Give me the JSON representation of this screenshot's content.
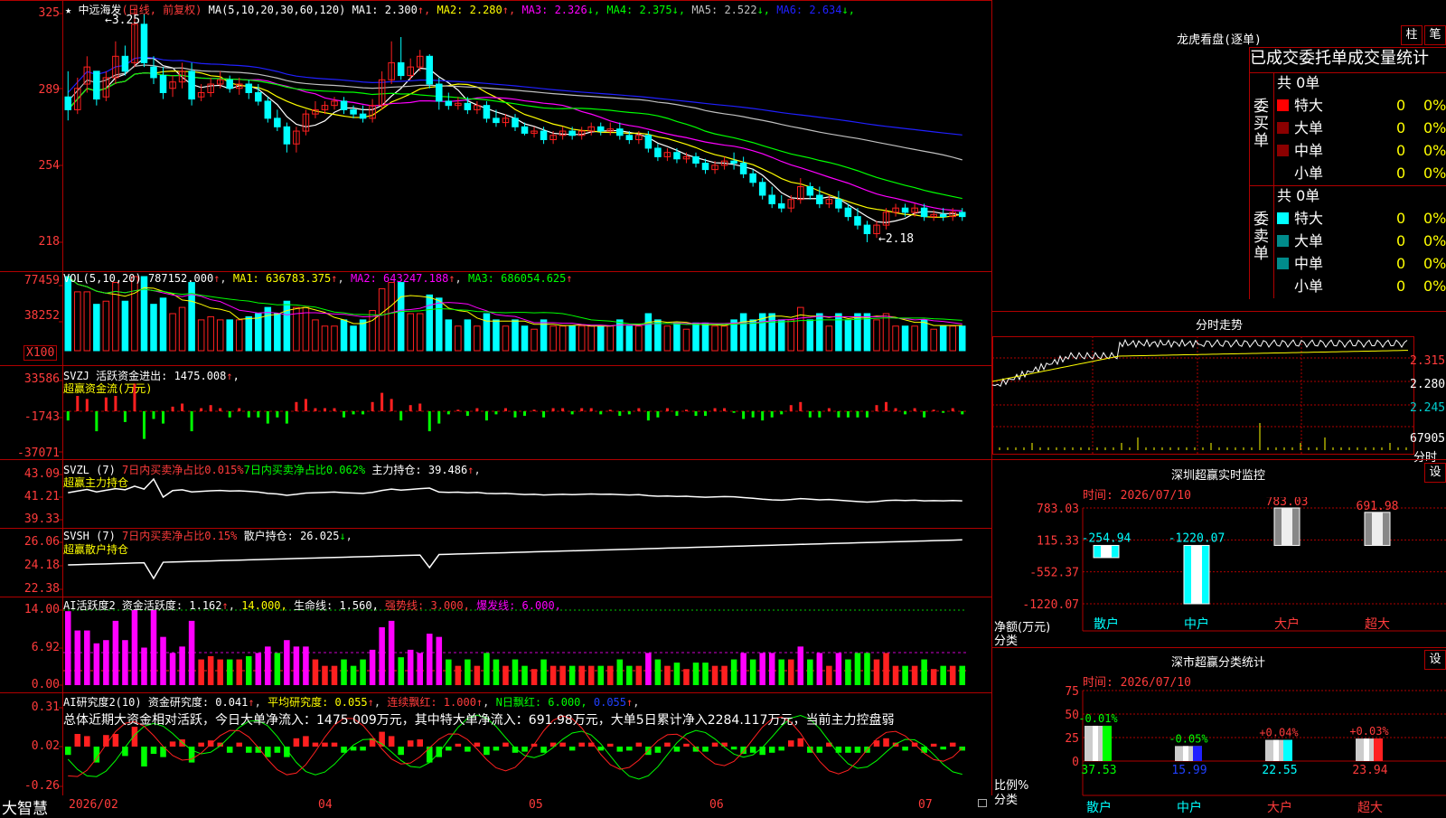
{
  "app": {
    "name": "大智慧"
  },
  "stock": {
    "name": "中远海发",
    "period": "(日线, 前复权)"
  },
  "kline": {
    "ma_header": "MA(5,10,20,30,60,120)",
    "ma": [
      {
        "label": "MA1:",
        "value": "2.300",
        "arrow": "↑",
        "color": "#ffffff"
      },
      {
        "label": "MA2:",
        "value": "2.280",
        "arrow": "↑",
        "color": "#ffff00"
      },
      {
        "label": "MA3:",
        "value": "2.326",
        "arrow": "↓",
        "color": "#ff00ff"
      },
      {
        "label": "MA4:",
        "value": "2.375",
        "arrow": "↓",
        "color": "#00ff00"
      },
      {
        "label": "MA5:",
        "value": "2.522",
        "arrow": "↓",
        "color": "#c0c0c0"
      },
      {
        "label": "MA6:",
        "value": "2.634",
        "arrow": "↓",
        "color": "#2020ff"
      }
    ],
    "y_ticks": [
      "325",
      "289",
      "254",
      "218"
    ],
    "high_mark": "3.25",
    "low_mark": "2.18",
    "candles": [
      [
        2.86,
        2.98,
        2.8,
        2.75
      ],
      [
        2.8,
        2.95,
        2.9,
        2.78
      ],
      [
        2.92,
        3.05,
        3.0,
        2.88
      ],
      [
        2.98,
        2.95,
        2.85,
        2.82
      ],
      [
        2.86,
        2.98,
        2.95,
        2.84
      ],
      [
        2.95,
        3.12,
        3.05,
        2.92
      ],
      [
        3.05,
        3.1,
        2.98,
        2.96
      ],
      [
        3.02,
        3.28,
        3.2,
        3.0
      ],
      [
        3.2,
        3.25,
        3.02,
        3.0
      ],
      [
        3.0,
        3.05,
        2.95,
        2.92
      ],
      [
        2.96,
        3.0,
        2.88,
        2.85
      ],
      [
        2.9,
        2.96,
        2.93,
        2.86
      ],
      [
        2.93,
        3.02,
        2.98,
        2.9
      ],
      [
        2.98,
        3.02,
        2.85,
        2.82
      ],
      [
        2.86,
        2.92,
        2.88,
        2.84
      ],
      [
        2.88,
        2.95,
        2.92,
        2.86
      ],
      [
        2.92,
        2.98,
        2.94,
        2.9
      ],
      [
        2.94,
        2.96,
        2.9,
        2.88
      ],
      [
        2.9,
        2.95,
        2.92,
        2.87
      ],
      [
        2.92,
        2.94,
        2.88,
        2.85
      ],
      [
        2.88,
        2.92,
        2.84,
        2.82
      ],
      [
        2.84,
        2.86,
        2.76,
        2.74
      ],
      [
        2.76,
        2.8,
        2.72,
        2.7
      ],
      [
        2.72,
        2.74,
        2.64,
        2.6
      ],
      [
        2.64,
        2.72,
        2.7,
        2.6
      ],
      [
        2.7,
        2.8,
        2.78,
        2.68
      ],
      [
        2.78,
        2.84,
        2.8,
        2.76
      ],
      [
        2.8,
        2.84,
        2.82,
        2.78
      ],
      [
        2.82,
        2.86,
        2.84,
        2.8
      ],
      [
        2.84,
        2.86,
        2.8,
        2.78
      ],
      [
        2.8,
        2.82,
        2.78,
        2.76
      ],
      [
        2.78,
        2.82,
        2.76,
        2.74
      ],
      [
        2.76,
        2.85,
        2.82,
        2.74
      ],
      [
        2.82,
        2.98,
        2.94,
        2.8
      ],
      [
        2.94,
        3.12,
        3.02,
        2.92
      ],
      [
        3.02,
        3.14,
        2.96,
        2.94
      ],
      [
        2.96,
        3.04,
        3.0,
        2.94
      ],
      [
        3.0,
        3.08,
        3.05,
        2.98
      ],
      [
        3.05,
        3.06,
        2.92,
        2.9
      ],
      [
        2.92,
        2.95,
        2.84,
        2.8
      ],
      [
        2.84,
        2.88,
        2.82,
        2.8
      ],
      [
        2.82,
        2.86,
        2.83,
        2.8
      ],
      [
        2.83,
        2.86,
        2.8,
        2.78
      ],
      [
        2.8,
        2.84,
        2.82,
        2.78
      ],
      [
        2.82,
        2.84,
        2.76,
        2.74
      ],
      [
        2.76,
        2.8,
        2.74,
        2.72
      ],
      [
        2.74,
        2.78,
        2.76,
        2.72
      ],
      [
        2.76,
        2.78,
        2.72,
        2.7
      ],
      [
        2.72,
        2.74,
        2.69,
        2.68
      ],
      [
        2.69,
        2.72,
        2.7,
        2.67
      ],
      [
        2.7,
        2.72,
        2.66,
        2.64
      ],
      [
        2.66,
        2.7,
        2.68,
        2.64
      ],
      [
        2.68,
        2.72,
        2.7,
        2.66
      ],
      [
        2.7,
        2.72,
        2.68,
        2.66
      ],
      [
        2.68,
        2.72,
        2.7,
        2.66
      ],
      [
        2.7,
        2.74,
        2.72,
        2.68
      ],
      [
        2.72,
        2.74,
        2.7,
        2.68
      ],
      [
        2.7,
        2.74,
        2.71,
        2.68
      ],
      [
        2.71,
        2.74,
        2.68,
        2.66
      ],
      [
        2.68,
        2.7,
        2.66,
        2.64
      ],
      [
        2.66,
        2.7,
        2.68,
        2.64
      ],
      [
        2.68,
        2.7,
        2.62,
        2.6
      ],
      [
        2.62,
        2.64,
        2.58,
        2.56
      ],
      [
        2.58,
        2.62,
        2.6,
        2.56
      ],
      [
        2.6,
        2.62,
        2.57,
        2.55
      ],
      [
        2.57,
        2.6,
        2.58,
        2.55
      ],
      [
        2.58,
        2.6,
        2.55,
        2.53
      ],
      [
        2.55,
        2.57,
        2.52,
        2.5
      ],
      [
        2.52,
        2.56,
        2.54,
        2.5
      ],
      [
        2.54,
        2.58,
        2.56,
        2.52
      ],
      [
        2.56,
        2.6,
        2.55,
        2.52
      ],
      [
        2.55,
        2.58,
        2.5,
        2.48
      ],
      [
        2.5,
        2.52,
        2.46,
        2.44
      ],
      [
        2.46,
        2.48,
        2.4,
        2.38
      ],
      [
        2.4,
        2.44,
        2.36,
        2.34
      ],
      [
        2.36,
        2.4,
        2.34,
        2.32
      ],
      [
        2.34,
        2.4,
        2.38,
        2.32
      ],
      [
        2.38,
        2.48,
        2.44,
        2.36
      ],
      [
        2.44,
        2.46,
        2.4,
        2.38
      ],
      [
        2.4,
        2.44,
        2.36,
        2.34
      ],
      [
        2.36,
        2.4,
        2.38,
        2.34
      ],
      [
        2.38,
        2.42,
        2.34,
        2.32
      ],
      [
        2.34,
        2.36,
        2.3,
        2.28
      ],
      [
        2.3,
        2.34,
        2.26,
        2.24
      ],
      [
        2.26,
        2.28,
        2.22,
        2.18
      ],
      [
        2.22,
        2.28,
        2.26,
        2.2
      ],
      [
        2.26,
        2.34,
        2.32,
        2.24
      ],
      [
        2.32,
        2.36,
        2.34,
        2.3
      ],
      [
        2.34,
        2.36,
        2.32,
        2.3
      ],
      [
        2.32,
        2.36,
        2.34,
        2.3
      ],
      [
        2.34,
        2.36,
        2.3,
        2.28
      ],
      [
        2.3,
        2.33,
        2.31,
        2.28
      ],
      [
        2.31,
        2.34,
        2.3,
        2.28
      ],
      [
        2.3,
        2.34,
        2.32,
        2.28
      ],
      [
        2.32,
        2.34,
        2.3,
        2.28
      ]
    ]
  },
  "vol": {
    "header": "VOL(5,10,20)",
    "value": "787152.000",
    "ma1": "MA1: 636783.375",
    "ma2": "MA2: 643247.188",
    "ma3": "MA3: 686054.625",
    "y_ticks": [
      "77459",
      "38252"
    ],
    "unit": "X100"
  },
  "svzj": {
    "header": "SVZJ  活跃资金进出: 1475.008",
    "subtitle": "超赢资金流(万元)",
    "y_ticks": [
      "33586",
      "-1743",
      "-37071"
    ]
  },
  "svzl": {
    "header_a": "SVZL (7)",
    "header_b": "7日内买卖净占比0.015%",
    "header_c": "7日内买卖净占比0.062%",
    "header_d": "主力持仓: 39.486",
    "subtitle": "超赢主力持仓",
    "y_ticks": [
      "43.09",
      "41.21",
      "39.33"
    ]
  },
  "svsh": {
    "header_a": "SVSH (7)",
    "header_b": "7日内买卖净占比0.15%",
    "header_c": "散户持仓: 26.025",
    "subtitle": "超赢散户持仓",
    "y_ticks": [
      "26.06",
      "24.18",
      "22.38"
    ]
  },
  "ai_active": {
    "header_a": "AI活跃度2",
    "header_b": "资金活跃度: 1.162",
    "header_c": "14.000,",
    "header_d": "生命线: 1.560,",
    "header_e": "强势线: 3.000,",
    "header_f": "爆发线: 6.000,",
    "y_ticks": [
      "14.00",
      "6.92",
      "0.00"
    ]
  },
  "ai_research": {
    "header_a": "AI研究度2(10)",
    "header_b": "资金研究度: 0.041",
    "header_c": "平均研究度: 0.055",
    "header_d": "连续飘红: 1.000",
    "header_e": "N日飘红: 6.000,",
    "header_f": "0.055",
    "comment": "总体近期大资金相对活跃，今日大单净流入：1475.009万元，其中特大单净流入：691.98万元，大单5日累计净入2284.117万元，当前主力控盘弱",
    "y_ticks": [
      "0.31",
      "0.02",
      "-0.26"
    ]
  },
  "xaxis": {
    "labels": [
      "2026/02",
      "04",
      "05",
      "06",
      "07"
    ]
  },
  "right": {
    "lhb": {
      "title": "龙虎看盘(逐单)",
      "btn_zhu": "柱",
      "btn_bi": "笔",
      "heading": "已成交委托单成交量统计",
      "buy_label": "委买单",
      "sell_label": "委卖单",
      "buy_total": "共 0单",
      "sell_total": "共 0单",
      "rows": [
        {
          "name": "特大",
          "count": "0",
          "pct": "0%"
        },
        {
          "name": "大单",
          "count": "0",
          "pct": "0%"
        },
        {
          "name": "中单",
          "count": "0",
          "pct": "0%"
        },
        {
          "name": "小单",
          "count": "0",
          "pct": "0%"
        }
      ]
    },
    "fenshi": {
      "title": "分时走势",
      "prices": [
        "2.315",
        "2.280",
        "2.245"
      ],
      "vol": "67905",
      "vol_unit": "分时"
    },
    "sz_monitor": {
      "title": "深圳超赢实时监控",
      "btn": "设",
      "time": "时间: 2026/07/10",
      "y_ticks": [
        "783.03",
        "115.33",
        "-552.37",
        "-1220.07"
      ],
      "ylabel": "净额(万元)",
      "xlabel": "分类",
      "categories": [
        "散户",
        "中户",
        "大户",
        "超大"
      ],
      "values": [
        -254.94,
        -1220.07,
        783.03,
        691.98
      ],
      "value_labels": [
        "-254.94",
        "-1220.07",
        "783.03",
        "691.98"
      ]
    },
    "sz_class": {
      "title": "深市超赢分类统计",
      "btn": "设",
      "time": "时间: 2026/07/10",
      "y_ticks": [
        "75",
        "50",
        "25",
        "0"
      ],
      "ylabel": "比例%",
      "xlabel": "分类",
      "categories": [
        "散户",
        "中户",
        "大户",
        "超大"
      ],
      "values": [
        37.53,
        15.99,
        22.55,
        23.94
      ],
      "changes": [
        "-0.01%",
        "-0.05%",
        "+0.04%",
        "+0.03%"
      ]
    }
  },
  "chart_data": [
    {
      "type": "bar",
      "title": "深圳超赢实时监控",
      "categories": [
        "散户",
        "中户",
        "大户",
        "超大"
      ],
      "values": [
        -254.94,
        -1220.07,
        783.03,
        691.98
      ],
      "ylabel": "净额(万元)",
      "xlabel": "分类",
      "ylim": [
        -1220.07,
        783.03
      ]
    },
    {
      "type": "bar",
      "title": "深市超赢分类统计",
      "categories": [
        "散户",
        "中户",
        "大户",
        "超大"
      ],
      "values": [
        37.53,
        15.99,
        22.55,
        23.94
      ],
      "ylabel": "比例%",
      "xlabel": "分类",
      "ylim": [
        0,
        75
      ]
    }
  ],
  "colors": {
    "up": "#ff2020",
    "down": "#00ffff",
    "grid": "#b00000",
    "axis_text": "#ff3b3b"
  }
}
